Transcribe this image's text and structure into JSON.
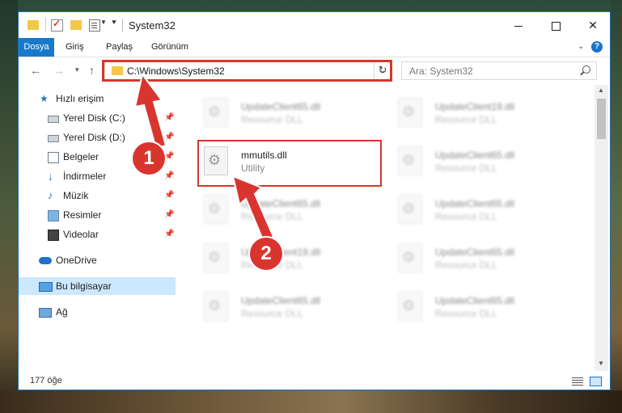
{
  "window": {
    "title": "System32",
    "controls": {
      "minimize": "minimize",
      "maximize": "maximize",
      "close": "✕"
    }
  },
  "ribbon": {
    "tabs": [
      "Dosya",
      "Giriş",
      "Paylaş",
      "Görünüm"
    ],
    "help": "?"
  },
  "navigation": {
    "address": "C:\\Windows\\System32",
    "refresh": "↻",
    "search_placeholder": "Ara: System32"
  },
  "sidebar": {
    "items": [
      {
        "label": "Hızlı erişim",
        "icon": "star-icon"
      },
      {
        "label": "Yerel Disk (C:)",
        "icon": "drive-icon",
        "pinned": true
      },
      {
        "label": "Yerel Disk (D:)",
        "icon": "drive-icon",
        "pinned": true
      },
      {
        "label": "Belgeler",
        "icon": "document-icon",
        "pinned": true
      },
      {
        "label": "İndirmeler",
        "icon": "download-icon",
        "pinned": true
      },
      {
        "label": "Müzik",
        "icon": "music-icon",
        "pinned": true
      },
      {
        "label": "Resimler",
        "icon": "picture-icon",
        "pinned": true
      },
      {
        "label": "Videolar",
        "icon": "video-icon",
        "pinned": true
      },
      {
        "label": "OneDrive",
        "icon": "cloud-icon"
      },
      {
        "label": "Bu bilgisayar",
        "icon": "computer-icon",
        "selected": true
      },
      {
        "label": "Ağ",
        "icon": "network-icon"
      }
    ]
  },
  "files": [
    {
      "name": "UpdateClient65.dll",
      "type": "Resource DLL"
    },
    {
      "name": "UpdateClient19.dll",
      "type": "Resource DLL"
    },
    {
      "name": "mmutils.dll",
      "type": "Utility"
    },
    {
      "name": "UpdateClient65.dll",
      "type": "Resource DLL"
    },
    {
      "name": "UpdateClient65.dll",
      "type": "Resource DLL"
    },
    {
      "name": "UpdateClient65.dll",
      "type": "Resource DLL"
    },
    {
      "name": "UpdateClient19.dll",
      "type": "Resource DLL"
    },
    {
      "name": "UpdateClient65.dll",
      "type": "Resource DLL"
    },
    {
      "name": "UpdateClient65.dll",
      "type": "Resource DLL"
    },
    {
      "name": "UpdateClient65.dll",
      "type": "Resource DLL"
    }
  ],
  "status": {
    "count": "177 öğe"
  },
  "annotations": {
    "callout_1": "1",
    "callout_2": "2"
  },
  "colors": {
    "accent": "#1979ca",
    "highlight": "#d9352e",
    "selection": "#cce8ff"
  }
}
